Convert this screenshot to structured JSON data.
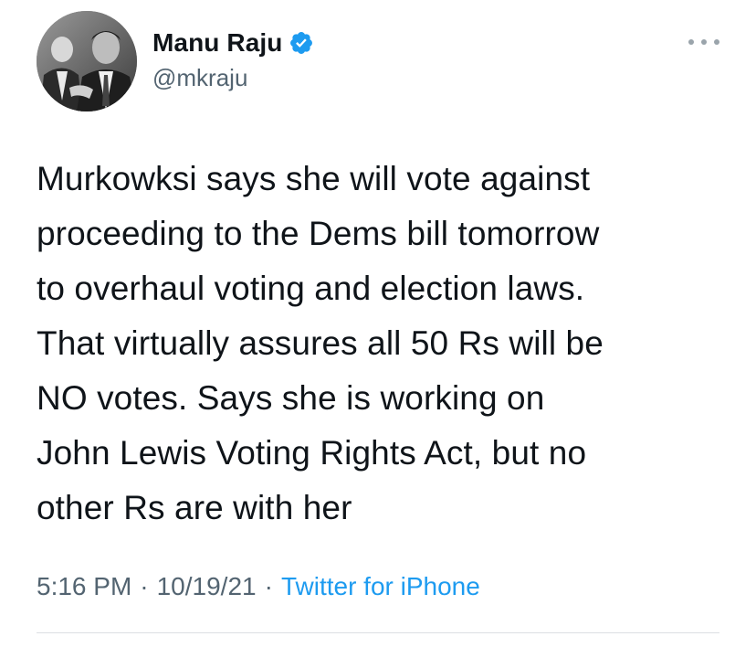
{
  "author": {
    "display_name": "Manu Raju",
    "handle": "@mkraju",
    "verified": true,
    "avatar_icon": "profile-photo"
  },
  "tweet": {
    "text": "Murkowksi says she will vote against\nproceeding to the Dems bill tomorrow\nto overhaul voting and election laws.\nThat virtually assures all 50 Rs will be\nNO votes. Says she is working on\nJohn Lewis Voting Rights Act, but no\nother Rs are with her",
    "time": "5:16 PM",
    "date": "10/19/21",
    "separator": "·",
    "source": "Twitter for iPhone"
  },
  "colors": {
    "text": "#0f1419",
    "secondary": "#536471",
    "accent": "#1d9bf0",
    "verified_badge": "#1d9bf0"
  },
  "icons": {
    "verified": "verified-badge-icon",
    "more": "more-options-icon"
  }
}
